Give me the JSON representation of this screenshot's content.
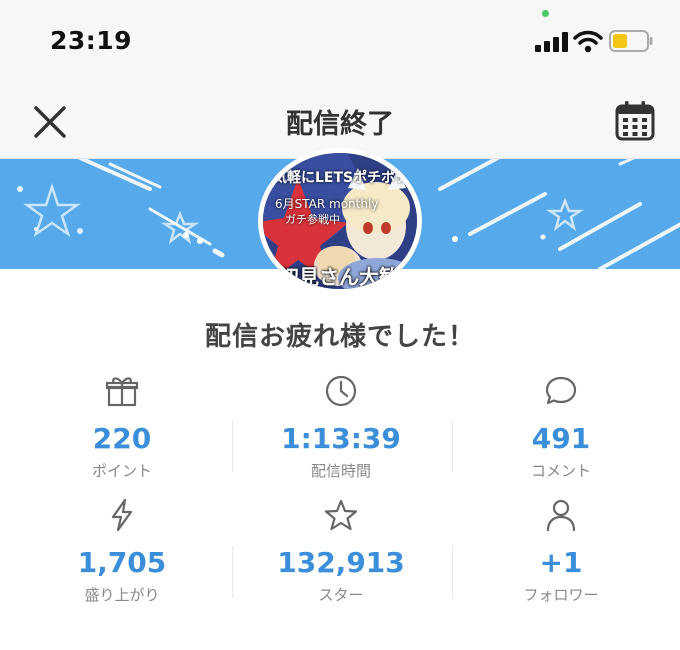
{
  "status_bar": {
    "time": "23:19"
  },
  "nav": {
    "title": "配信終了"
  },
  "avatar": {
    "text_top": "気軽にLETSポチポチ",
    "text_mid": "6月STAR monthly",
    "text_mid2": "ガチ参戦中",
    "text_bottom": "初見さん大歓迎"
  },
  "message": "配信お疲れ様でした！",
  "stats": [
    {
      "icon": "gift-icon",
      "value": "220",
      "label": "ポイント"
    },
    {
      "icon": "clock-icon",
      "value": "1:13:39",
      "label": "配信時間"
    },
    {
      "icon": "comment-icon",
      "value": "491",
      "label": "コメント"
    },
    {
      "icon": "lightning-icon",
      "value": "1,705",
      "label": "盛り上がり"
    },
    {
      "icon": "star-icon",
      "value": "132,913",
      "label": "スター"
    },
    {
      "icon": "person-icon",
      "value": "+1",
      "label": "フォロワー"
    }
  ],
  "colors": {
    "accent": "#3b8ed9",
    "banner": "#56a9ea"
  }
}
